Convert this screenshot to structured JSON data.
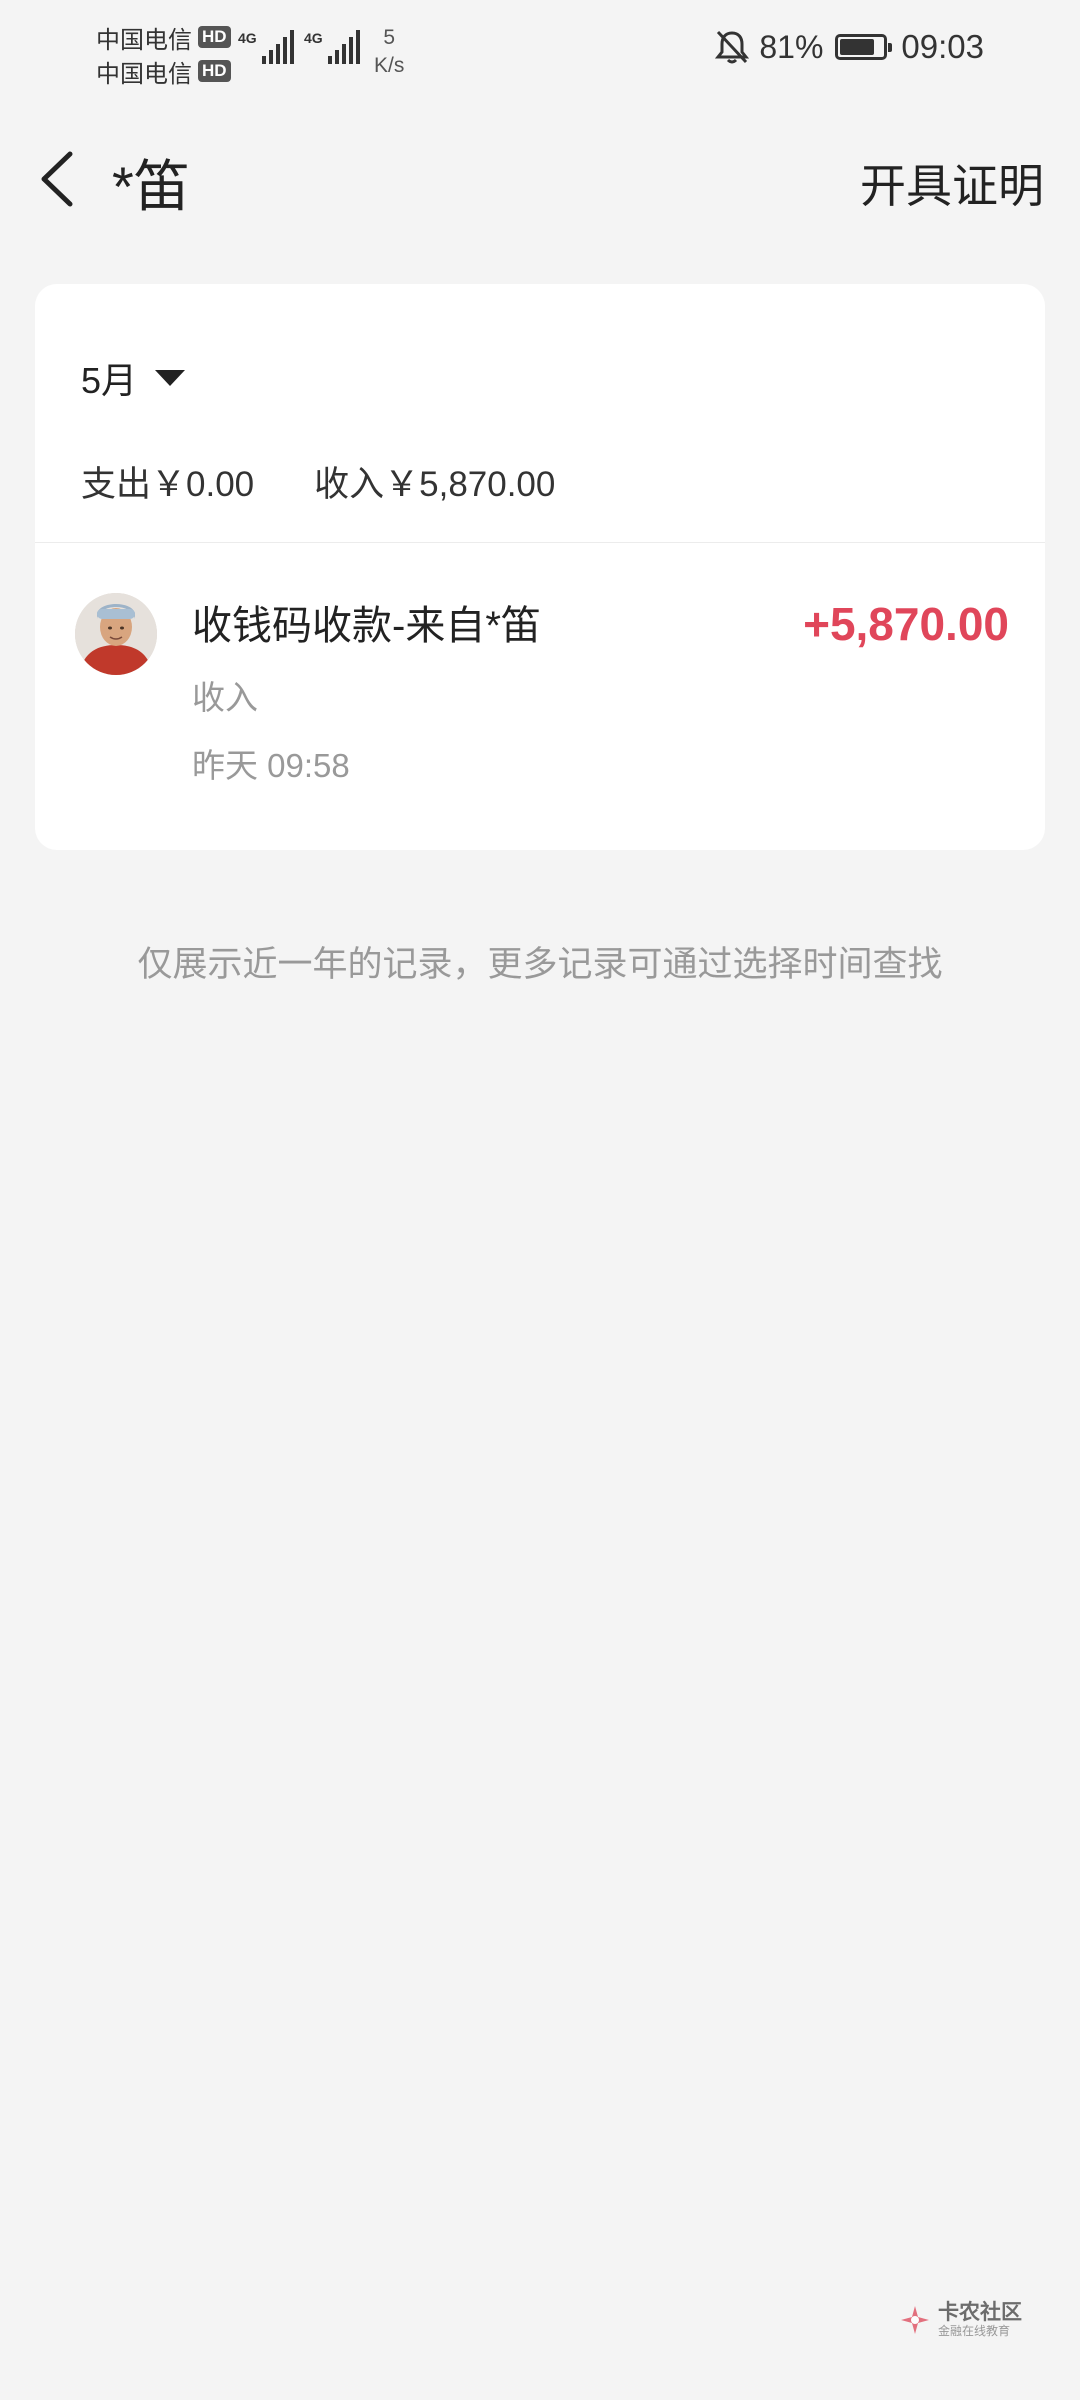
{
  "status_bar": {
    "carrier_1": "中国电信",
    "carrier_2": "中国电信",
    "hd_label": "HD",
    "net_type_1": "4G",
    "net_type_2": "4G",
    "speed_value": "5",
    "speed_unit": "K/s",
    "battery_percent": "81%",
    "battery_level": 0.81,
    "time": "09:03"
  },
  "header": {
    "title": "*笛",
    "action_label": "开具证明"
  },
  "summary": {
    "month": "5月",
    "expense": "支出￥0.00",
    "income": "收入￥5,870.00"
  },
  "transactions": [
    {
      "title": "收钱码收款-来自*笛",
      "type": "收入",
      "time": "昨天 09:58",
      "amount": "+5,870.00",
      "amount_color": "#e0465a"
    }
  ],
  "footer_note": "仅展示近一年的记录，更多记录可通过选择时间查找",
  "watermark": {
    "title": "卡农社区",
    "subtitle": "金融在线教育"
  }
}
